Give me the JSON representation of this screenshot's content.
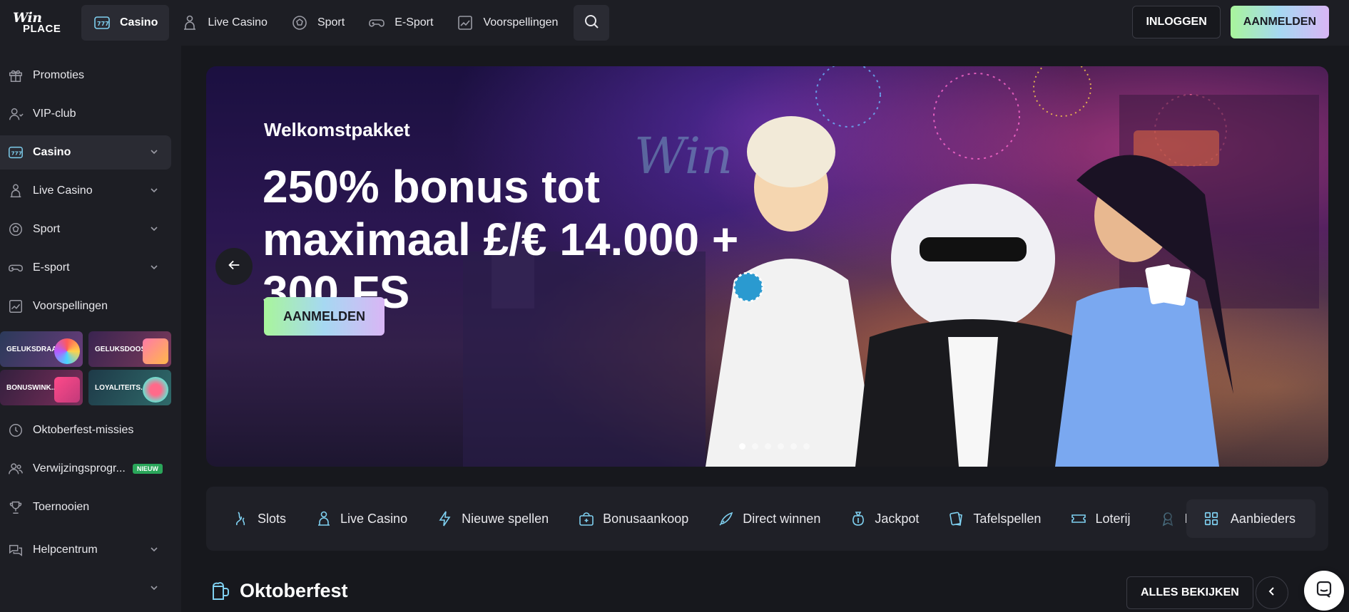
{
  "header": {
    "logo_line1": "Win",
    "logo_line2": "PLACE",
    "nav": [
      {
        "label": "Casino",
        "icon": "casino-777-icon",
        "active": true
      },
      {
        "label": "Live Casino",
        "icon": "dealer-icon"
      },
      {
        "label": "Sport",
        "icon": "soccer-ball-icon"
      },
      {
        "label": "E-Sport",
        "icon": "gamepad-icon"
      },
      {
        "label": "Voorspellingen",
        "icon": "chart-icon"
      }
    ],
    "login_label": "INLOGGEN",
    "signup_label": "AANMELDEN"
  },
  "sidebar": {
    "items": [
      {
        "label": "Promoties",
        "icon": "gift-icon"
      },
      {
        "label": "VIP-club",
        "icon": "vip-user-icon"
      },
      {
        "label": "Casino",
        "icon": "casino-777-icon",
        "active": true,
        "expandable": true
      },
      {
        "label": "Live Casino",
        "icon": "dealer-icon",
        "expandable": true
      },
      {
        "label": "Sport",
        "icon": "soccer-ball-icon",
        "expandable": true
      },
      {
        "label": "E-sport",
        "icon": "gamepad-icon",
        "expandable": true
      },
      {
        "label": "Voorspellingen",
        "icon": "chart-icon"
      }
    ],
    "promo_tiles": [
      "GELUKSDRAAI",
      "GELUKSDOOS",
      "BONUSWINK...",
      "LOYALITEITS..."
    ],
    "items_lower": [
      {
        "label": "Oktoberfest-missies",
        "icon": "mission-icon"
      },
      {
        "label": "Verwijzingsprogr...",
        "icon": "referral-icon",
        "badge": "NIEUW"
      },
      {
        "label": "Toernooien",
        "icon": "trophy-icon"
      },
      {
        "label": "Helpcentrum",
        "icon": "chat-bubbles-icon",
        "expandable": true
      }
    ]
  },
  "hero": {
    "title": "Welkomstpakket",
    "headline": "250% bonus tot maximaal £/€ 14.000 + 300 FS",
    "cta_label": "AANMELDEN",
    "slide_count": 6,
    "active_slide": 1
  },
  "categories": {
    "items": [
      {
        "label": "Slots",
        "icon": "slots-icon"
      },
      {
        "label": "Live Casino",
        "icon": "dealer-icon"
      },
      {
        "label": "Nieuwe spellen",
        "icon": "lightning-icon"
      },
      {
        "label": "Bonusaankoop",
        "icon": "bonus-buy-icon"
      },
      {
        "label": "Direct winnen",
        "icon": "rocket-icon"
      },
      {
        "label": "Jackpot",
        "icon": "money-bag-icon"
      },
      {
        "label": "Tafelspellen",
        "icon": "cards-icon"
      },
      {
        "label": "Loterij",
        "icon": "ticket-icon"
      },
      {
        "label": "Bl",
        "icon": "badge-icon"
      }
    ],
    "providers_label": "Aanbieders"
  },
  "section": {
    "title": "Oktoberfest",
    "view_all_label": "ALLES BEKIJKEN"
  },
  "colors": {
    "accent_gradient": [
      "#a8f59b",
      "#a6d8f2",
      "#d9b6f5"
    ],
    "background": "#17181d",
    "panel": "#1d1e24",
    "icon_accent": "#7fd0f0",
    "badge_green": "#2aa65a"
  }
}
